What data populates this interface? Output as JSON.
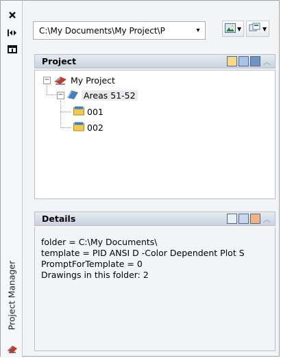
{
  "palette": {
    "title": "Project Manager"
  },
  "toolbar": {
    "path": "C:\\My Documents\\My Project\\P",
    "path_dropdown_arrow": "▾"
  },
  "project_panel": {
    "title": "Project",
    "tree": [
      {
        "label": "My Project",
        "icon": "project-icon"
      },
      {
        "label": "Areas 51-52",
        "icon": "area-folder-icon"
      },
      {
        "label": "001",
        "icon": "drawing-folder-icon"
      },
      {
        "label": "002",
        "icon": "drawing-folder-icon"
      }
    ]
  },
  "details_panel": {
    "title": "Details",
    "lines": [
      "folder = C:\\My Documents\\",
      "template = PID ANSI D -Color Dependent Plot S",
      "PromptForTemplate = 0",
      "Drawings in this folder: 2"
    ]
  },
  "colors": {
    "header_bg": "#d3dbe6",
    "icon_blue": "#3a6ea5",
    "folder_yellow": "#f2c94c",
    "chevron": "#9fb3cc"
  }
}
